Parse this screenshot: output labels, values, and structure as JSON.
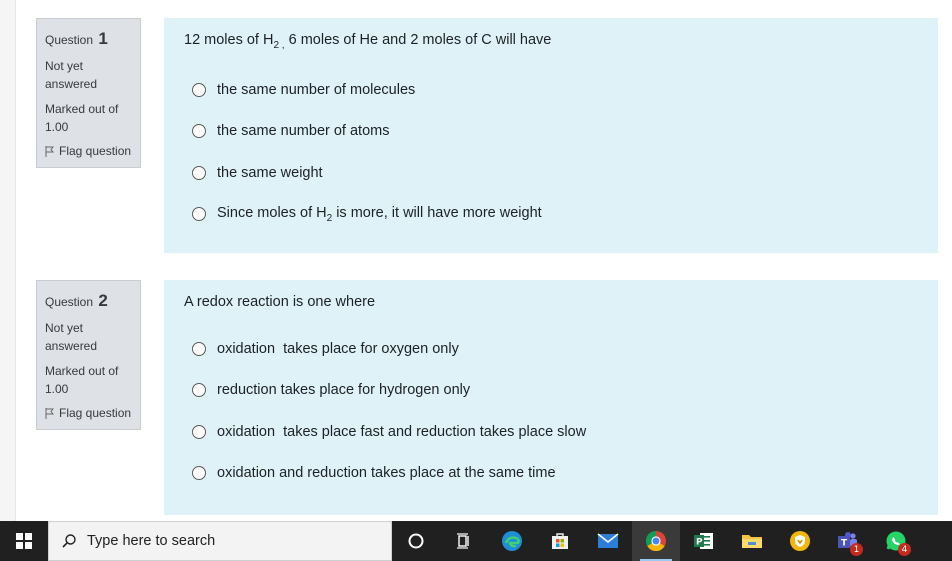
{
  "questions": [
    {
      "label": "Question",
      "number": "1",
      "state": "Not yet answered",
      "grade": "Marked out of 1.00",
      "flag_label": "Flag question",
      "text": "12 moles of H",
      "text_sub": "2 ,",
      "text_rest": " 6 moles of He and 2 moles of C will have",
      "options": [
        {
          "label": "the same number of molecules"
        },
        {
          "label": "the same number of atoms"
        },
        {
          "label": "the same weight"
        },
        {
          "label_pre": "Since moles of H",
          "label_sub": "2",
          "label_post": " is more, it will have more weight"
        }
      ]
    },
    {
      "label": "Question",
      "number": "2",
      "state": "Not yet answered",
      "grade": "Marked out of 1.00",
      "flag_label": "Flag question",
      "text": "A redox reaction is one where",
      "options": [
        {
          "label": "oxidation  takes place for oxygen only"
        },
        {
          "label": "reduction takes place for hydrogen only"
        },
        {
          "label": "oxidation  takes place fast and reduction takes place slow"
        },
        {
          "label": "oxidation and reduction takes place at the same time"
        }
      ]
    }
  ],
  "taskbar": {
    "search_placeholder": "Type here to search",
    "icons": [
      "windows-icon",
      "search-icon",
      "cortana-icon",
      "task-view-icon",
      "edge-icon",
      "store-icon",
      "mail-icon",
      "chrome-icon",
      "project-icon",
      "file-explorer-icon",
      "vpn-shield-icon",
      "teams-icon",
      "whatsapp-icon"
    ],
    "teams_badge": "1",
    "whatsapp_badge": "4"
  },
  "colors": {
    "question_content_bg": "#def2f8",
    "question_info_bg": "#dee2e6",
    "taskbar_bg": "#202020"
  }
}
